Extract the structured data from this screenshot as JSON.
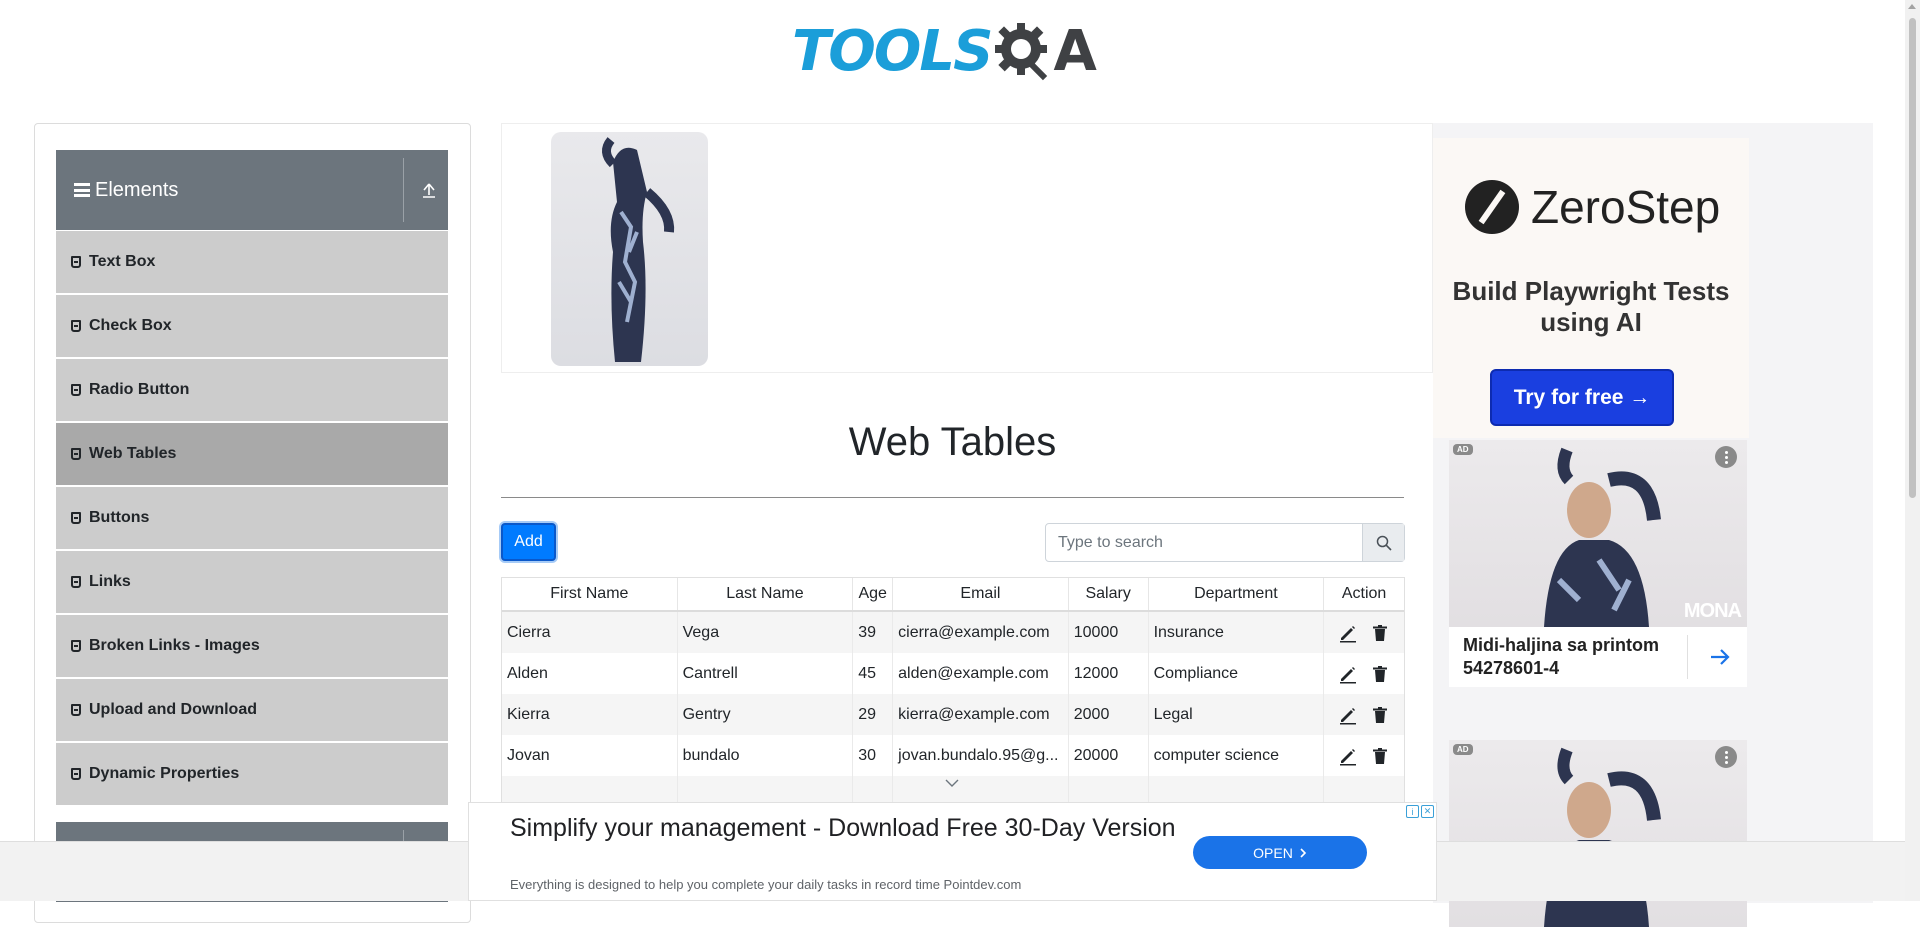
{
  "header": {
    "logo_text": "TOOLS",
    "logo_tail": "A",
    "logo_full": "TOOLSQA"
  },
  "sidebar": {
    "group_title": "Elements",
    "items": [
      {
        "label": "Text Box",
        "active": false
      },
      {
        "label": "Check Box",
        "active": false
      },
      {
        "label": "Radio Button",
        "active": false
      },
      {
        "label": "Web Tables",
        "active": true
      },
      {
        "label": "Buttons",
        "active": false
      },
      {
        "label": "Links",
        "active": false
      },
      {
        "label": "Broken Links - Images",
        "active": false
      },
      {
        "label": "Upload and Download",
        "active": false
      },
      {
        "label": "Dynamic Properties",
        "active": false
      }
    ]
  },
  "main": {
    "title": "Web Tables",
    "add_label": "Add",
    "search": {
      "placeholder": "Type to search",
      "value": ""
    },
    "table": {
      "columns": [
        "First Name",
        "Last Name",
        "Age",
        "Email",
        "Salary",
        "Department",
        "Action"
      ],
      "rows": [
        [
          "Cierra",
          "Vega",
          "39",
          "cierra@example.com",
          "10000",
          "Insurance"
        ],
        [
          "Alden",
          "Cantrell",
          "45",
          "alden@example.com",
          "12000",
          "Compliance"
        ],
        [
          "Kierra",
          "Gentry",
          "29",
          "kierra@example.com",
          "2000",
          "Legal"
        ],
        [
          "Jovan",
          "bundalo",
          "30",
          "jovan.bundalo.95@g...",
          "20000",
          "computer science"
        ]
      ]
    }
  },
  "ads": {
    "zerostep": {
      "brand": "ZeroStep",
      "tagline": "Build Playwright Tests using AI",
      "cta": "Try for free →"
    },
    "product": {
      "badge": "AD",
      "brand": "MONA",
      "title": "Midi-haljina sa printom 54278601-4"
    },
    "bottom": {
      "headline": "Simplify your management - Download Free 30-Day Version",
      "sub": "Everything is designed to help you complete your daily tasks in record time Pointdev.com",
      "cta": "OPEN"
    }
  },
  "colors": {
    "brand_blue": "#1b9ed9",
    "primary": "#007bff",
    "sidebar_header": "#6c757d",
    "menu_item": "#cccccc",
    "menu_active": "#a9a9a9"
  }
}
